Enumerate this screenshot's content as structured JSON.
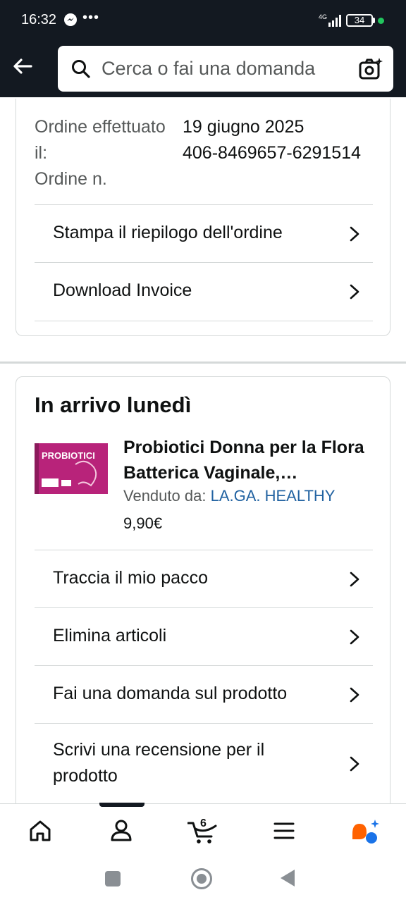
{
  "status": {
    "time": "16:32",
    "dots": "•••",
    "network": "4G",
    "battery": "34"
  },
  "header": {
    "search_placeholder": "Cerca o fai una domanda"
  },
  "order": {
    "placed_label": "Ordine effettuato il:",
    "number_label": "Ordine n.",
    "placed_value": "19 giugno 2025",
    "number_value": "406-8469657-6291514",
    "actions": [
      {
        "label": "Stampa il riepilogo dell'ordine"
      },
      {
        "label": "Download Invoice"
      }
    ]
  },
  "shipment": {
    "heading": "In arrivo lunedì",
    "product": {
      "title": "Probiotici Donna per la Flora Batterica Vaginale,…",
      "seller_label": "Venduto da:",
      "seller_name": "LA.GA. HEALTHY",
      "price": "9,90€",
      "image_text": "PROBIOTICI"
    },
    "actions": [
      {
        "label": "Traccia il mio pacco"
      },
      {
        "label": "Elimina articoli"
      },
      {
        "label": "Fai una domanda sul prodotto"
      },
      {
        "label": "Scrivi una recensione per il prodotto"
      }
    ]
  },
  "bottom_nav": {
    "items": [
      "home-icon",
      "account-icon",
      "cart-icon",
      "menu-icon",
      "rufus-icon"
    ],
    "cart_count": "6",
    "active_index": 1
  },
  "colors": {
    "header_bg": "#131921",
    "link": "#2162a1",
    "accent": "#ff6200"
  }
}
